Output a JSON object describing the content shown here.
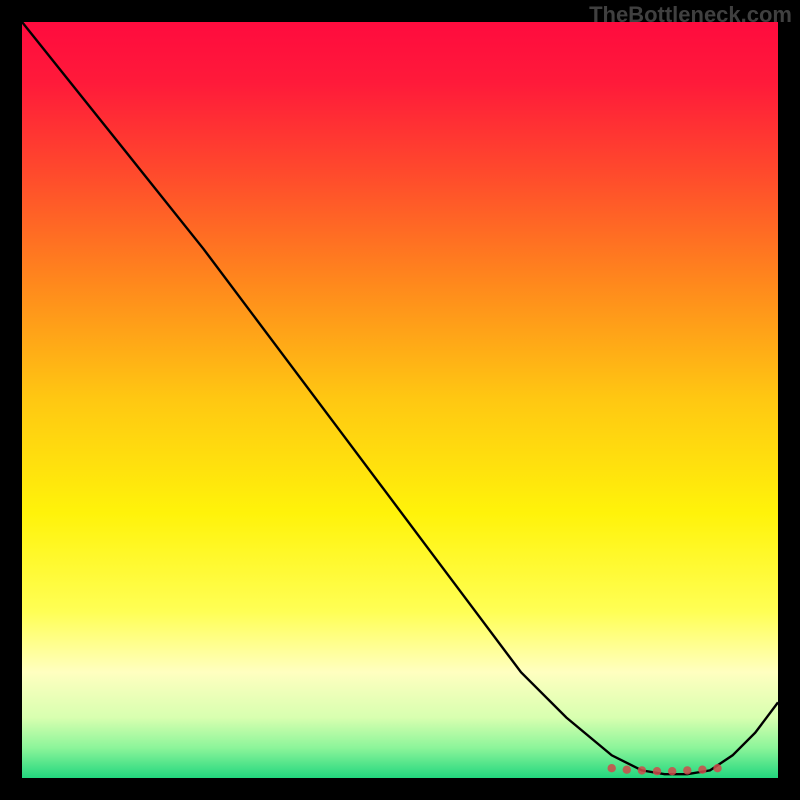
{
  "watermark": "TheBottleneck.com",
  "chart_data": {
    "type": "line",
    "title": "",
    "xlabel": "",
    "ylabel": "",
    "xlim": [
      0,
      100
    ],
    "ylim": [
      0,
      100
    ],
    "background_gradient": {
      "type": "vertical",
      "stops": [
        {
          "pos": 0.0,
          "color": "#ff0b3e"
        },
        {
          "pos": 0.08,
          "color": "#ff1a3a"
        },
        {
          "pos": 0.2,
          "color": "#ff4a2c"
        },
        {
          "pos": 0.35,
          "color": "#ff8a1c"
        },
        {
          "pos": 0.5,
          "color": "#ffc812"
        },
        {
          "pos": 0.65,
          "color": "#fff30a"
        },
        {
          "pos": 0.78,
          "color": "#ffff55"
        },
        {
          "pos": 0.86,
          "color": "#ffffc0"
        },
        {
          "pos": 0.92,
          "color": "#d8ffb0"
        },
        {
          "pos": 0.96,
          "color": "#8cf59a"
        },
        {
          "pos": 1.0,
          "color": "#22d67e"
        }
      ]
    },
    "series": [
      {
        "name": "curve",
        "color": "#000000",
        "x": [
          0,
          8,
          16,
          24,
          30,
          36,
          42,
          48,
          54,
          60,
          66,
          72,
          78,
          82,
          85,
          88,
          91,
          94,
          97,
          100
        ],
        "y": [
          100,
          90,
          80,
          70,
          62,
          54,
          46,
          38,
          30,
          22,
          14,
          8,
          3,
          1,
          0.5,
          0.5,
          1,
          3,
          6,
          10
        ]
      },
      {
        "name": "markers",
        "type": "scatter",
        "color": "#d04a4a",
        "x": [
          78,
          80,
          82,
          84,
          86,
          88,
          90,
          92
        ],
        "y": [
          1.3,
          1.1,
          1.0,
          0.9,
          0.9,
          1.0,
          1.1,
          1.3
        ]
      }
    ]
  }
}
